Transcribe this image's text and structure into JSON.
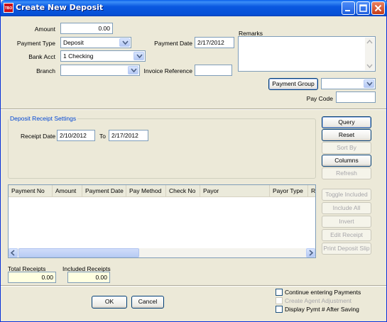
{
  "window": {
    "title": "Create New Deposit",
    "app_badge": "TBO"
  },
  "form": {
    "amount_label": "Amount",
    "amount_value": "0.00",
    "payment_type_label": "Payment Type",
    "payment_type_value": "Deposit",
    "bank_acct_label": "Bank Acct",
    "bank_acct_value": "1 Checking",
    "branch_label": "Branch",
    "branch_value": "",
    "payment_date_label": "Payment Date",
    "payment_date_value": "2/17/2012",
    "invoice_reference_label": "Invoice Reference",
    "invoice_reference_value": "",
    "remarks_label": "Remarks",
    "remarks_value": "",
    "payment_group_button": "Payment Group",
    "payment_group_value": "",
    "pay_code_label": "Pay Code",
    "pay_code_value": ""
  },
  "receipt_settings": {
    "title": "Deposit Receipt Settings",
    "receipt_date_label": "Receipt Date",
    "from_value": "2/10/2012",
    "to_label": "To",
    "to_value": "2/17/2012"
  },
  "side_buttons": {
    "query": "Query",
    "reset": "Reset",
    "sort_by": "Sort By",
    "columns": "Columns",
    "refresh": "Refresh",
    "toggle_included": "Toggle Included",
    "include_all": "Include All",
    "invert": "Invert",
    "edit_receipt": "Edit Receipt",
    "print_deposit_slip": "Print Deposit Slip"
  },
  "grid": {
    "columns": [
      "Payment No",
      "Amount",
      "Payment Date",
      "Pay Method",
      "Check No",
      "Payor",
      "Payor Type",
      "Re"
    ],
    "rows": []
  },
  "totals": {
    "total_receipts_label": "Total Receipts",
    "total_receipts_value": "0.00",
    "included_receipts_label": "Included Receipts",
    "included_receipts_value": "0.00"
  },
  "footer": {
    "ok": "OK",
    "cancel": "Cancel",
    "continue_entering": "Continue entering Payments",
    "create_agent_adjustment": "Create Agent Adjustment",
    "display_pymt": "Display Pymt # After Saving"
  },
  "colors": {
    "title_bar": "#0a58e0",
    "face": "#ece9d8",
    "group_title": "#0046d5",
    "total_field": "#ffffe1"
  }
}
